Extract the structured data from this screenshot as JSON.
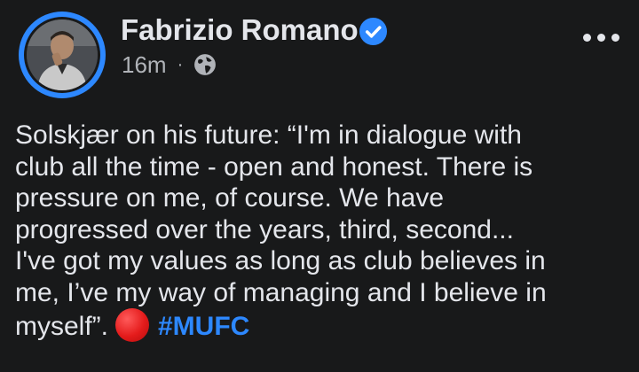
{
  "post": {
    "author_name": "Fabrizio Romano",
    "verified": true,
    "timestamp": "16m",
    "separator": "·",
    "audience_icon": "globe-icon",
    "more_icon": "more-options-icon",
    "text_lines": [
      "Solskjær on his future: “I'm in dialogue with",
      "club all the time - open and honest. There is",
      "pressure on me, of course. We have",
      "progressed over the years, third, second...",
      "I've got my values as long as club believes in",
      "me, I’ve my way of managing and I believe in",
      "myself”."
    ],
    "emoji": "red-circle-emoji",
    "hashtag": "#MUFC"
  },
  "colors": {
    "background": "#18191a",
    "text": "#e4e6eb",
    "secondary_text": "#b0b3b8",
    "accent": "#2d88ff",
    "red_circle": "#e41b1b"
  }
}
